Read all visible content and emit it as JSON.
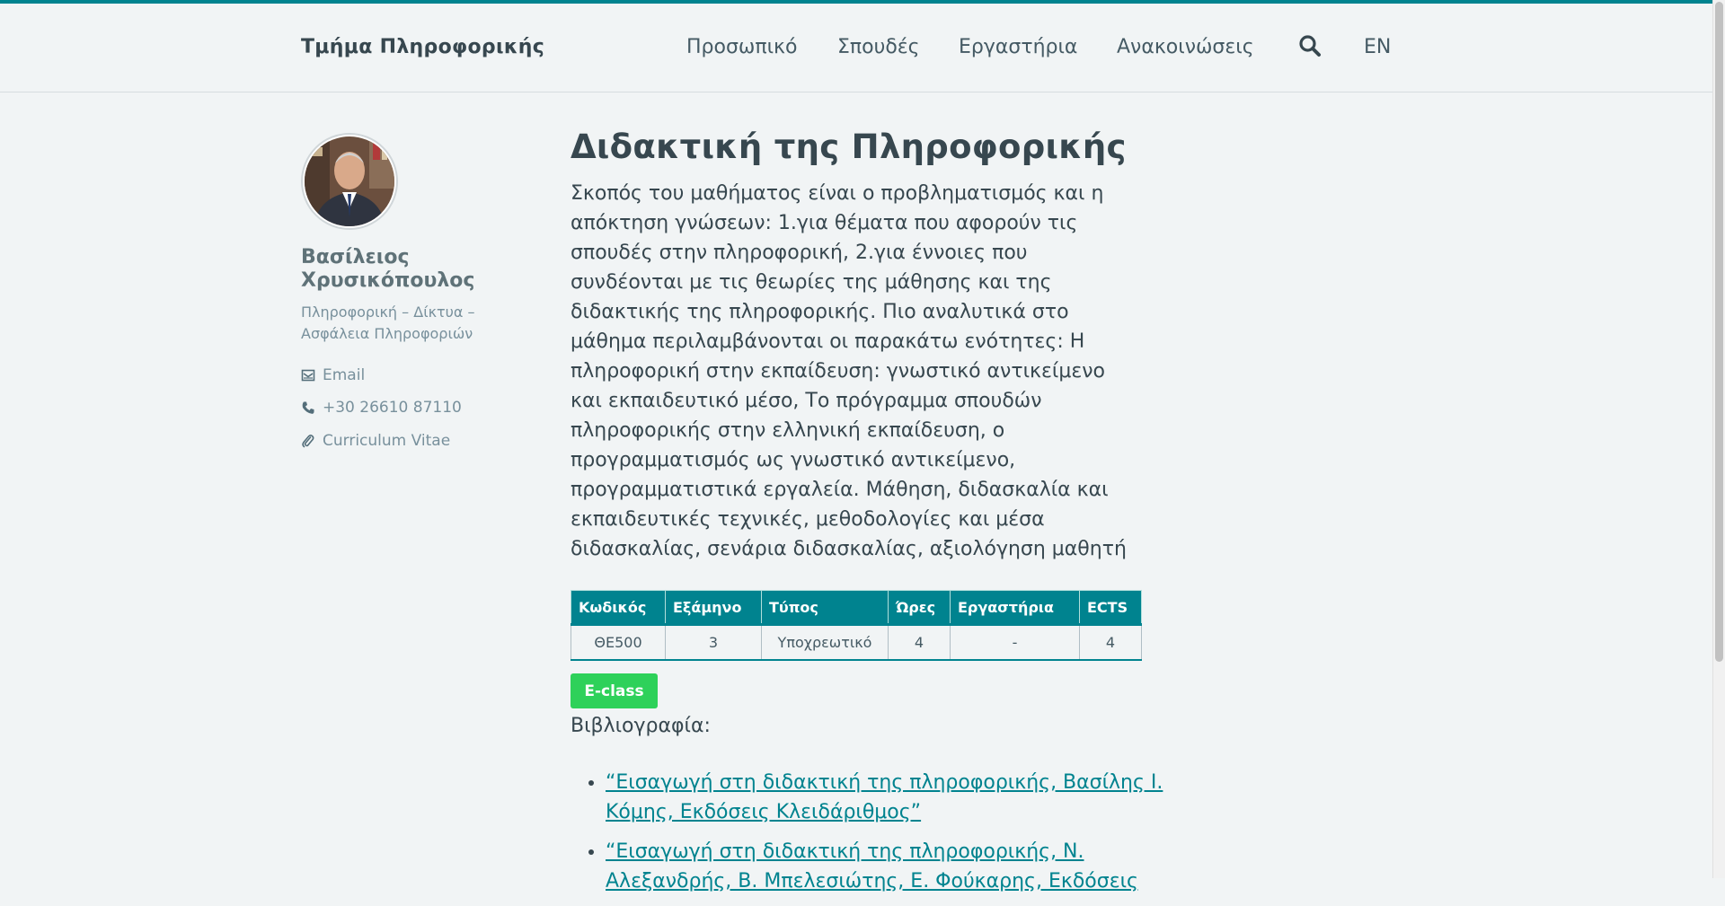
{
  "header": {
    "site_title": "Τμήμα Πληροφορικής",
    "nav": [
      "Προσωπικό",
      "Σπουδές",
      "Εργαστήρια",
      "Ανακοινώσεις"
    ],
    "search_icon": "search-icon",
    "lang": "EN",
    "accent_color": "#00838f"
  },
  "sidebar": {
    "name": "Βασίλειος Χρυσικόπουλος",
    "area": "Πληροφορική – Δίκτυα – Ασφάλεια Πληροφοριών",
    "contacts": [
      {
        "icon": "envelope-icon",
        "label": "Email"
      },
      {
        "icon": "phone-icon",
        "label": "+30 26610 87110"
      },
      {
        "icon": "paperclip-icon",
        "label": "Curriculum Vitae"
      }
    ]
  },
  "course": {
    "title": "Διδακτική της Πληροφορικής",
    "description": "Σκοπός του μαθήματος είναι ο προβληματισμός και η απόκτηση γνώσεων: 1.για θέματα που αφορούν τις σπουδές στην πληροφορική, 2.για έννοιες που συνδέονται με τις θεωρίες της μάθησης και της διδακτικής της πληροφορικής. Πιο αναλυτικά στο μάθημα περιλαμβάνονται οι παρακάτω ενότητες: Η πληροφορική στην εκπαίδευση: γνωστικό αντικείμενο και εκπαιδευτικό μέσο, Το πρόγραμμα σπουδών πληροφορικής στην ελληνική εκπαίδευση, ο προγραμματισμός ως γνωστικό αντικείμενο, προγραμματιστικά εργαλεία. Μάθηση, διδασκαλία και εκπαιδευτικές τεχνικές, μεθοδολογίες και μέσα διδασκαλίας, σενάρια διδασκαλίας, αξιολόγηση μαθητή",
    "table": {
      "headers": [
        "Κωδικός",
        "Εξάμηνο",
        "Τύπος",
        "Ώρες",
        "Εργαστήρια",
        "ECTS"
      ],
      "row": [
        "ΘΕ500",
        "3",
        "Υποχρεωτικό",
        "4",
        "-",
        "4"
      ]
    },
    "eclass_label": "E-class",
    "eclass_color": "#2ed15a",
    "biblio_label": "Βιβλιογραφία:",
    "bibliography": [
      "“Εισαγωγή στη διδακτική της πληροφορικής, Βασίλης Ι. Κόμης, Εκδόσεις Κλειδάριθμος”",
      "“Εισαγωγή στη διδακτική της πληροφορικής, Ν. Αλεξανδρής, Β. Μπελεσιώτης, Ε. Φούκαρης, Εκδόσεις"
    ]
  }
}
